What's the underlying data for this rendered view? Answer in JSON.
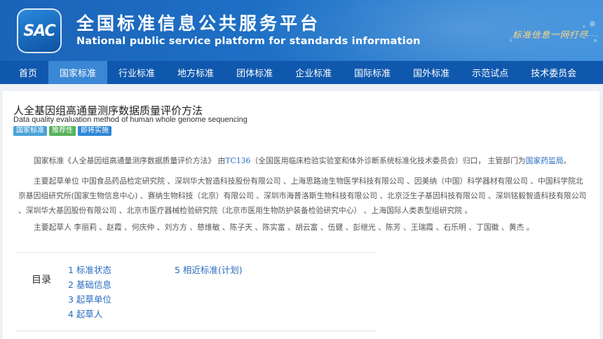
{
  "header": {
    "logo_text": "SAC",
    "site_name_cn": "全国标准信息公共服务平台",
    "site_name_en": "National public service platform  for standards information",
    "slogan": "标准信息一网打尽"
  },
  "nav": {
    "items": [
      "首页",
      "国家标准",
      "行业标准",
      "地方标准",
      "团体标准",
      "企业标准",
      "国际标准",
      "国外标准",
      "示范试点",
      "技术委员会"
    ],
    "active_index": 1
  },
  "standard": {
    "title_cn": "人全基因组高通量测序数据质量评价方法",
    "title_en": "Data quality evaluation method of human whole genome sequencing",
    "tags": [
      {
        "label": "国家标准",
        "color": "#4aa3d8"
      },
      {
        "label": "推荐性",
        "color": "#56b35a"
      },
      {
        "label": "即将实施",
        "color": "#2f86d6"
      }
    ],
    "intro": {
      "prefix": "国家标准《人全基因组高通量测序数据质量评价方法》 由",
      "tc_link": "TC136",
      "middle": "（全国医用临床检验实验室和体外诊断系统标准化技术委员会）归口， 主管部门为",
      "dept_link": "国家药监局",
      "suffix": "。"
    },
    "drafting_units": "主要起草单位 中国食品药品检定研究院 、深圳华大智造科技股份有限公司 、上海思路迪生物医学科技有限公司 、因美纳（中国）科学器材有限公司 、中国科学院北京基因组研究所(国家生物信息中心) 、赛纳生物科技（北京）有限公司 、深圳市海普洛斯生物科技有限公司 、北京泛生子基因科技有限公司 、深圳铭毅智造科技有限公司 、深圳华大基因股份有限公司 、北京市医疗器械检验研究院（北京市医用生物防护装备检验研究中心） 、上海国际人类表型组研究院 。",
    "drafters": "主要起草人 李丽莉 、赵霞 、何庆仲 、刘方方 、慈维敏 、陈子天 、陈实富 、胡云富 、伍健 、彭继光 、陈芳 、王瑞霞 、石乐明 、丁国徽 、黄杰 。"
  },
  "toc": {
    "label": "目录",
    "items": [
      "1  标准状态",
      "2  基础信息",
      "3  起草单位",
      "4  起草人",
      "5  相近标准(计划)"
    ]
  }
}
